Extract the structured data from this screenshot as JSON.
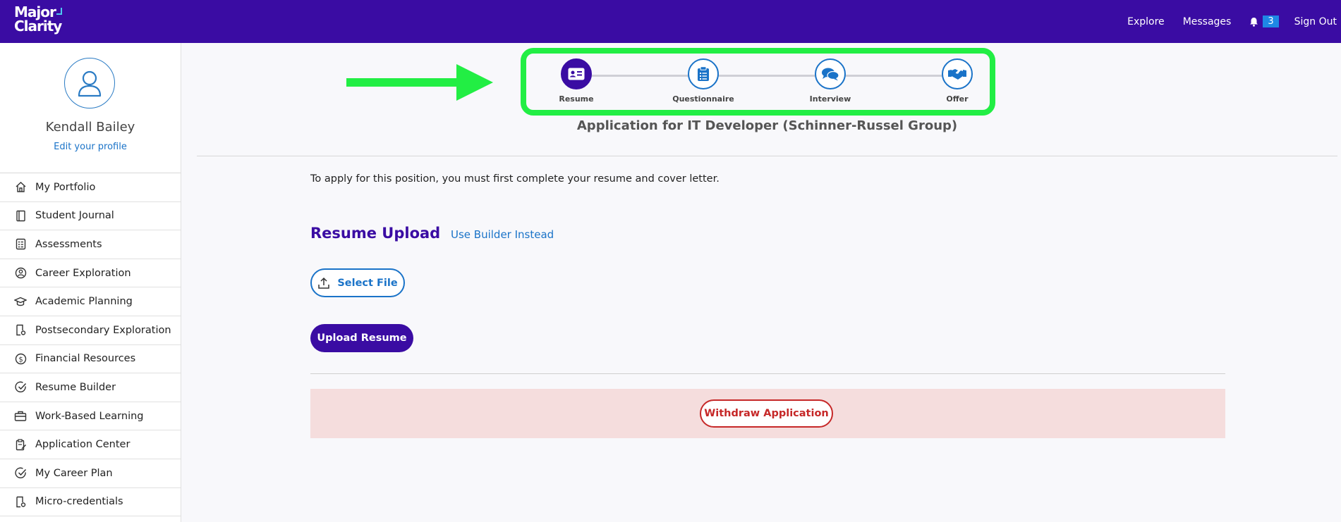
{
  "brand": {
    "line1": "Major",
    "line2": "Clarity"
  },
  "topnav": {
    "explore": "Explore",
    "messages": "Messages",
    "notifications_count": "3",
    "sign_out": "Sign Out"
  },
  "profile": {
    "name": "Kendall Bailey",
    "edit_link": "Edit your profile"
  },
  "sidebar": {
    "items": [
      {
        "label": "My Portfolio",
        "icon": "home-icon"
      },
      {
        "label": "Student Journal",
        "icon": "journal-icon"
      },
      {
        "label": "Assessments",
        "icon": "assessment-icon"
      },
      {
        "label": "Career Exploration",
        "icon": "person-circle-icon"
      },
      {
        "label": "Academic Planning",
        "icon": "graduation-cap-icon"
      },
      {
        "label": "Postsecondary Exploration",
        "icon": "document-gear-icon"
      },
      {
        "label": "Financial Resources",
        "icon": "dollar-circle-icon"
      },
      {
        "label": "Resume Builder",
        "icon": "check-circle-icon"
      },
      {
        "label": "Work-Based Learning",
        "icon": "briefcase-icon"
      },
      {
        "label": "Application Center",
        "icon": "clipboard-edit-icon"
      },
      {
        "label": "My Career Plan",
        "icon": "check-circle-icon"
      },
      {
        "label": "Micro-credentials",
        "icon": "document-gear-icon"
      }
    ]
  },
  "stepper": {
    "steps": [
      {
        "label": "Resume",
        "active": true,
        "icon": "id-card-icon"
      },
      {
        "label": "Questionnaire",
        "active": false,
        "icon": "clipboard-icon"
      },
      {
        "label": "Interview",
        "active": false,
        "icon": "chat-bubbles-icon"
      },
      {
        "label": "Offer",
        "active": false,
        "icon": "handshake-icon"
      }
    ]
  },
  "main": {
    "title": "Application for IT Developer (Schinner-Russel Group)",
    "intro": "To apply for this position, you must first complete your resume and cover letter.",
    "section_title": "Resume Upload",
    "builder_link": "Use Builder Instead",
    "select_file": "Select File",
    "upload_button": "Upload Resume",
    "withdraw_button": "Withdraw Application"
  },
  "colors": {
    "brand_purple": "#3a0ca3",
    "link_blue": "#1a73c8",
    "highlight_green": "#22ee44",
    "withdraw_red": "#c62828",
    "withdraw_panel_bg": "#f5dddd"
  }
}
